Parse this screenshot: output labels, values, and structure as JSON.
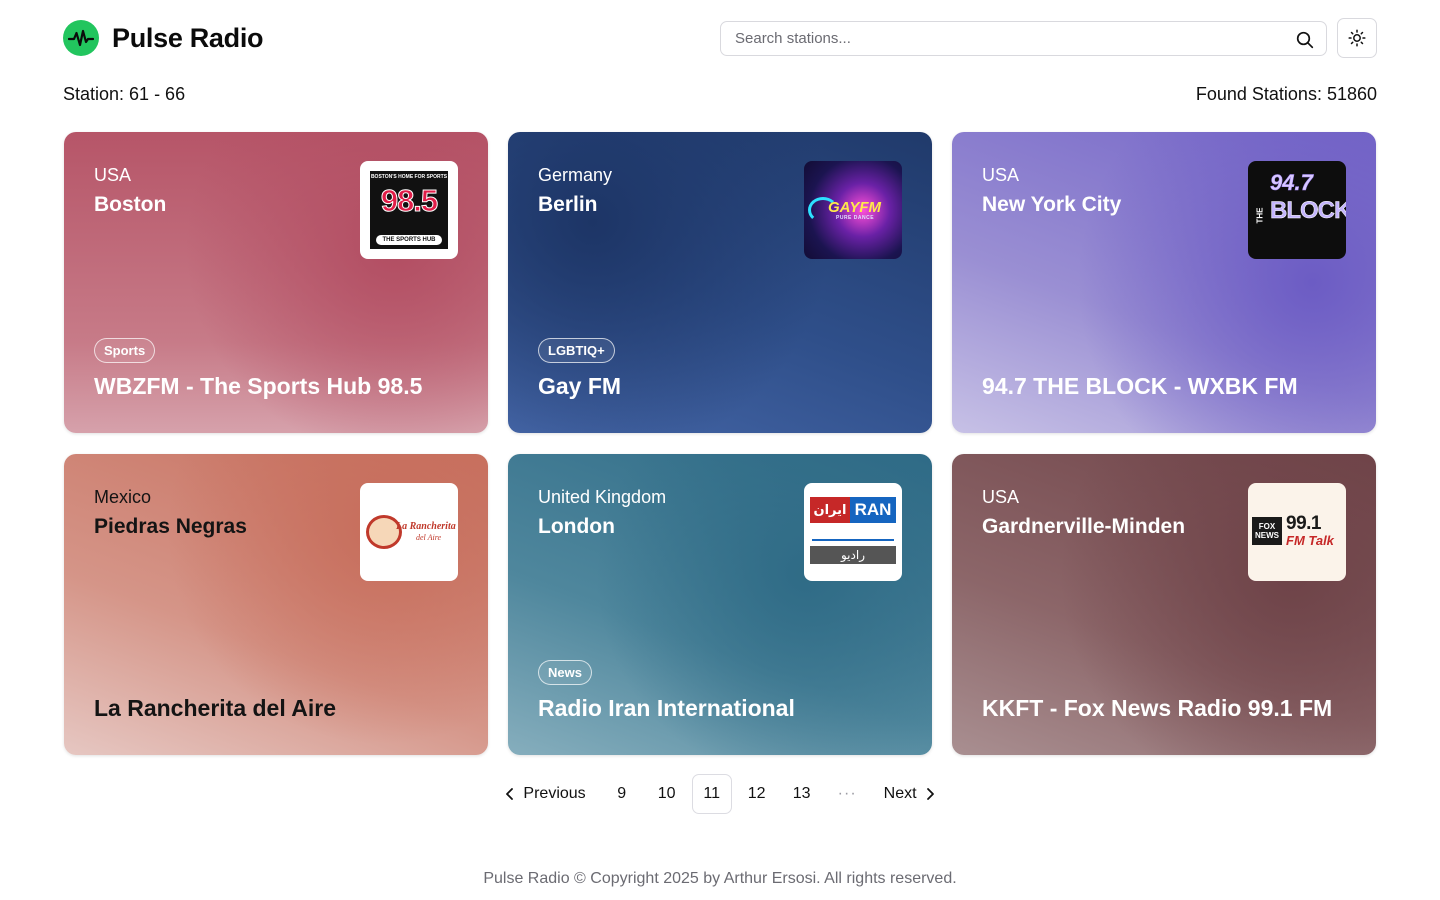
{
  "app": {
    "title": "Pulse Radio",
    "accent": "#22c55e"
  },
  "search": {
    "placeholder": "Search stations..."
  },
  "icons": {
    "logo": "pulse-waveform-icon",
    "search": "magnifier-icon",
    "theme": "sun-icon",
    "prev": "chevron-left-icon",
    "next": "chevron-right-icon"
  },
  "summary": {
    "range": "Station: 61 - 66",
    "found": "Found Stations: 51860"
  },
  "stations": [
    {
      "country": "USA",
      "city": "Boston",
      "tag": "Sports",
      "name": "WBZFM - The Sports Hub 98.5",
      "theme": "light",
      "logo_text": "98.5",
      "logo_top": "BOSTON'S HOME FOR SPORTS",
      "logo_bottom": "THE SPORTS HUB"
    },
    {
      "country": "Germany",
      "city": "Berlin",
      "tag": "LGBTIQ+",
      "name": "Gay FM",
      "theme": "light",
      "logo_text": "GAYFM",
      "logo_top": "",
      "logo_bottom": "PURE DANCE"
    },
    {
      "country": "USA",
      "city": "New York City",
      "tag": "",
      "name": "94.7 THE BLOCK - WXBK FM",
      "theme": "light",
      "logo_text": "94.7",
      "logo_top": "THE",
      "logo_bottom": "BLOCK"
    },
    {
      "country": "Mexico",
      "city": "Piedras Negras",
      "tag": "",
      "name": "La Rancherita del Aire",
      "theme": "dark",
      "logo_text": "La Rancherita",
      "logo_top": "",
      "logo_bottom": "del Aire"
    },
    {
      "country": "United Kingdom",
      "city": "London",
      "tag": "News",
      "name": "Radio Iran International",
      "theme": "light",
      "logo_text": "RAN",
      "logo_top": "ایران",
      "logo_bottom": "رادیو"
    },
    {
      "country": "USA",
      "city": "Gardnerville-Minden",
      "tag": "",
      "name": "KKFT - Fox News Radio 99.1 FM",
      "theme": "light",
      "logo_text": "99.1",
      "logo_top": "FOX NEWS",
      "logo_bottom": "FM Talk"
    }
  ],
  "pagination": {
    "previous": "Previous",
    "next": "Next",
    "pages": [
      "9",
      "10",
      "11",
      "12",
      "13"
    ],
    "current": "11",
    "ellipsis": "···"
  },
  "footer": {
    "text": "Pulse Radio © Copyright 2025 by Arthur Ersosi. All rights reserved."
  }
}
